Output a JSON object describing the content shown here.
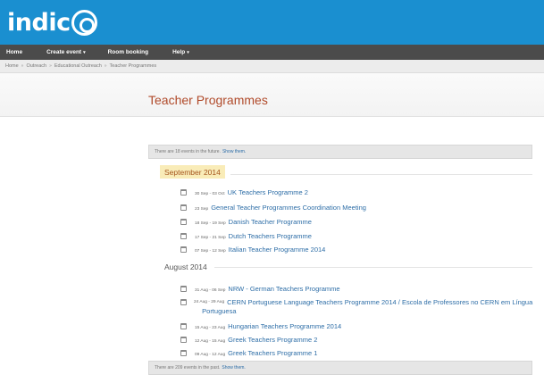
{
  "header": {
    "logo_text": "indico"
  },
  "menu": [
    {
      "label": "Home",
      "caret": ""
    },
    {
      "label": "Create event",
      "caret": "▾"
    },
    {
      "label": "Room booking",
      "caret": ""
    },
    {
      "label": "Help",
      "caret": "▾"
    }
  ],
  "breadcrumb": [
    "Home",
    "Outreach",
    "Educational Outreach",
    "Teacher Programmes"
  ],
  "breadcrumb_sep": "»",
  "page_title": "Teacher Programmes",
  "future_notice": {
    "text": "There are 18 events in the future.",
    "link": "Show them."
  },
  "past_notice": {
    "text": "There are 209 events in the past.",
    "link": "Show them."
  },
  "months": [
    {
      "label": "September 2014",
      "events": [
        {
          "date": "30 Sep - 03 Oct",
          "title": "UK Teachers Programme 2"
        },
        {
          "date": "23 Sep",
          "title": "General Teacher Programmes Coordination Meeting"
        },
        {
          "date": "18 Sep - 19 Sep",
          "title": "Danish Teacher Programme"
        },
        {
          "date": "17 Sep - 21 Sep",
          "title": "Dutch Teachers Programme"
        },
        {
          "date": "07 Sep - 12 Sep",
          "title": "Italian Teacher Programme 2014"
        }
      ]
    },
    {
      "label": "August 2014",
      "events": [
        {
          "date": "31 Aug - 06 Sep",
          "title": "NRW - German Teachers Programme"
        },
        {
          "date": "24 Aug - 29 Aug",
          "title": "CERN Portuguese Language Teachers Programme 2014 / Escola de Professores no CERN em Língua Portuguesa"
        },
        {
          "date": "15 Aug - 23 Aug",
          "title": "Hungarian Teachers Programme 2014"
        },
        {
          "date": "12 Aug - 15 Aug",
          "title": "Greek Teachers Programme 2"
        },
        {
          "date": "09 Aug - 12 Aug",
          "title": "Greek Teachers Programme 1"
        }
      ]
    }
  ]
}
